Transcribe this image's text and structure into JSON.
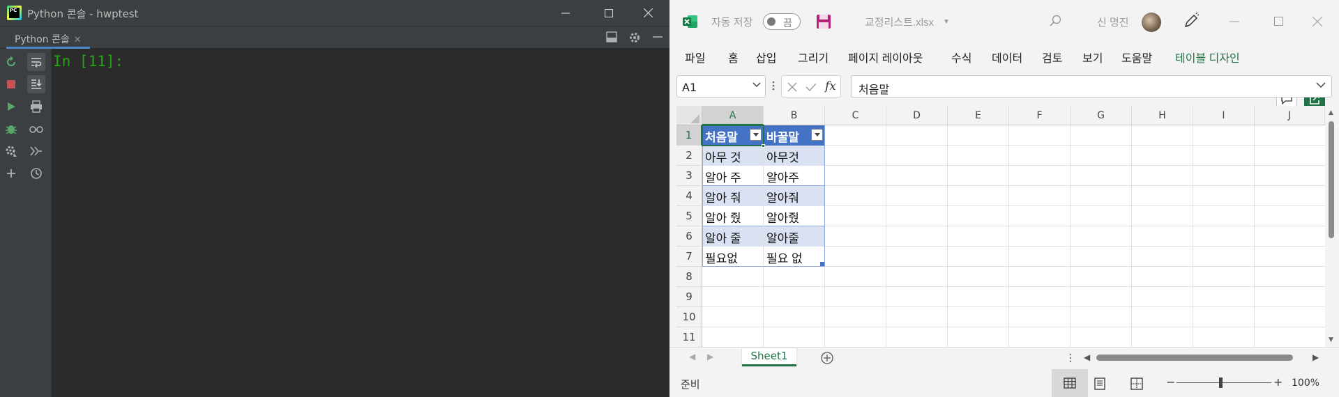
{
  "pycharm": {
    "title": "Python 콘솔 - hwptest",
    "tab_label": "Python 콘솔",
    "prompt": "In [11]:",
    "colors": {
      "prompt": "#26a319",
      "accent": "#4a88c7",
      "bg": "#2b2b2b"
    },
    "left_toolbar_icons": [
      "rerun-icon",
      "stop-icon",
      "run-icon",
      "debug-icon",
      "settings-icon",
      "add-icon"
    ],
    "second_toolbar_icons": [
      "soft-wrap-icon",
      "scroll-to-end-icon",
      "print-icon",
      "glasses-icon",
      "execute-icon",
      "history-icon"
    ]
  },
  "excel": {
    "autosave_label": "자동 저장",
    "autosave_state": "끔",
    "filename": "교정리스트.xlsx",
    "user_name": "신 명진",
    "menu": [
      "파일",
      "홈",
      "삽입",
      "그리기",
      "페이지 레이아웃",
      "수식",
      "데이터",
      "검토",
      "보기",
      "도움말",
      "테이블 디자인"
    ],
    "active_menu": "테이블 디자인",
    "namebox": "A1",
    "formula": "처음말",
    "fx": "fx",
    "columns": [
      "A",
      "B",
      "C",
      "D",
      "E",
      "F",
      "G",
      "H",
      "I",
      "J"
    ],
    "rows": [
      "1",
      "2",
      "3",
      "4",
      "5",
      "6",
      "7",
      "8",
      "9",
      "10",
      "11"
    ],
    "table": {
      "headers": [
        "처음말",
        "바꿀말"
      ],
      "rows": [
        [
          "아무 것",
          "아무것"
        ],
        [
          "알아 주",
          "알아주"
        ],
        [
          "알아 줘",
          "알아줘"
        ],
        [
          "알아 줬",
          "알아줬"
        ],
        [
          "알아 줄",
          "알아줄"
        ],
        [
          "필요없",
          "필요 없"
        ]
      ]
    },
    "sheet_tab": "Sheet1",
    "status_text": "준비",
    "zoom": "100%",
    "zoom_minus": "−",
    "zoom_plus": "+",
    "colors": {
      "brand": "#217346",
      "table_header": "#4472c4",
      "table_band": "#d9e1f2"
    }
  }
}
